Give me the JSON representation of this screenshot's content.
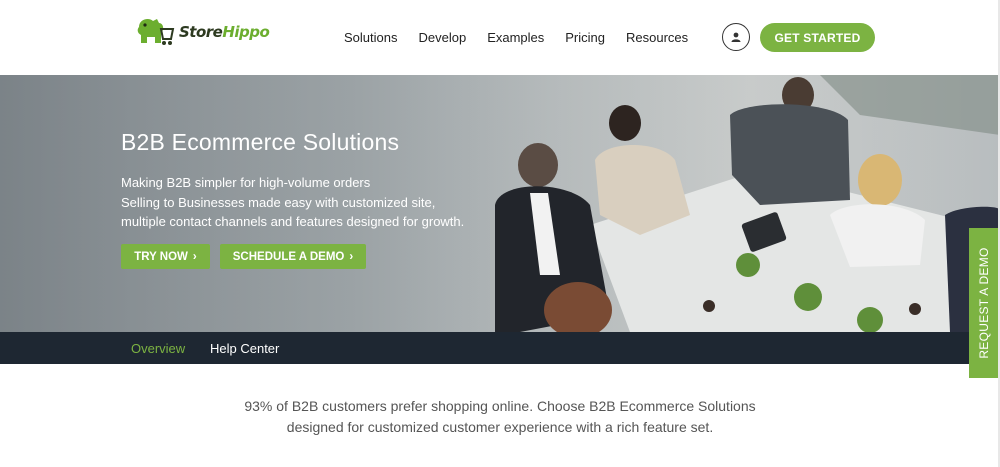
{
  "brand": {
    "name_part1": "Store",
    "name_part2": "Hippo",
    "primary_color": "#7cb342",
    "dark_color": "#1e2732"
  },
  "header": {
    "nav": [
      "Solutions",
      "Develop",
      "Examples",
      "Pricing",
      "Resources"
    ],
    "user_icon": "user-icon",
    "cta_label": "GET STARTED"
  },
  "hero": {
    "title": "B2B Ecommerce Solutions",
    "description_lines": [
      "Making B2B simpler for high-volume orders",
      "Selling to Businesses made easy with customized site,",
      "multiple contact channels and features designed for growth."
    ],
    "try_now_label": "TRY NOW",
    "schedule_demo_label": "SCHEDULE A DEMO",
    "chevron_icon": "chevron-right-icon"
  },
  "subnav": {
    "items": [
      "Overview",
      "Help Center"
    ],
    "active": "Overview"
  },
  "intro": {
    "lines": [
      "93% of B2B customers prefer shopping online. Choose B2B Ecommerce Solutions",
      "designed for customized customer experience with a rich feature set."
    ]
  },
  "side_tab": {
    "label": "REQUEST A DEMO"
  }
}
